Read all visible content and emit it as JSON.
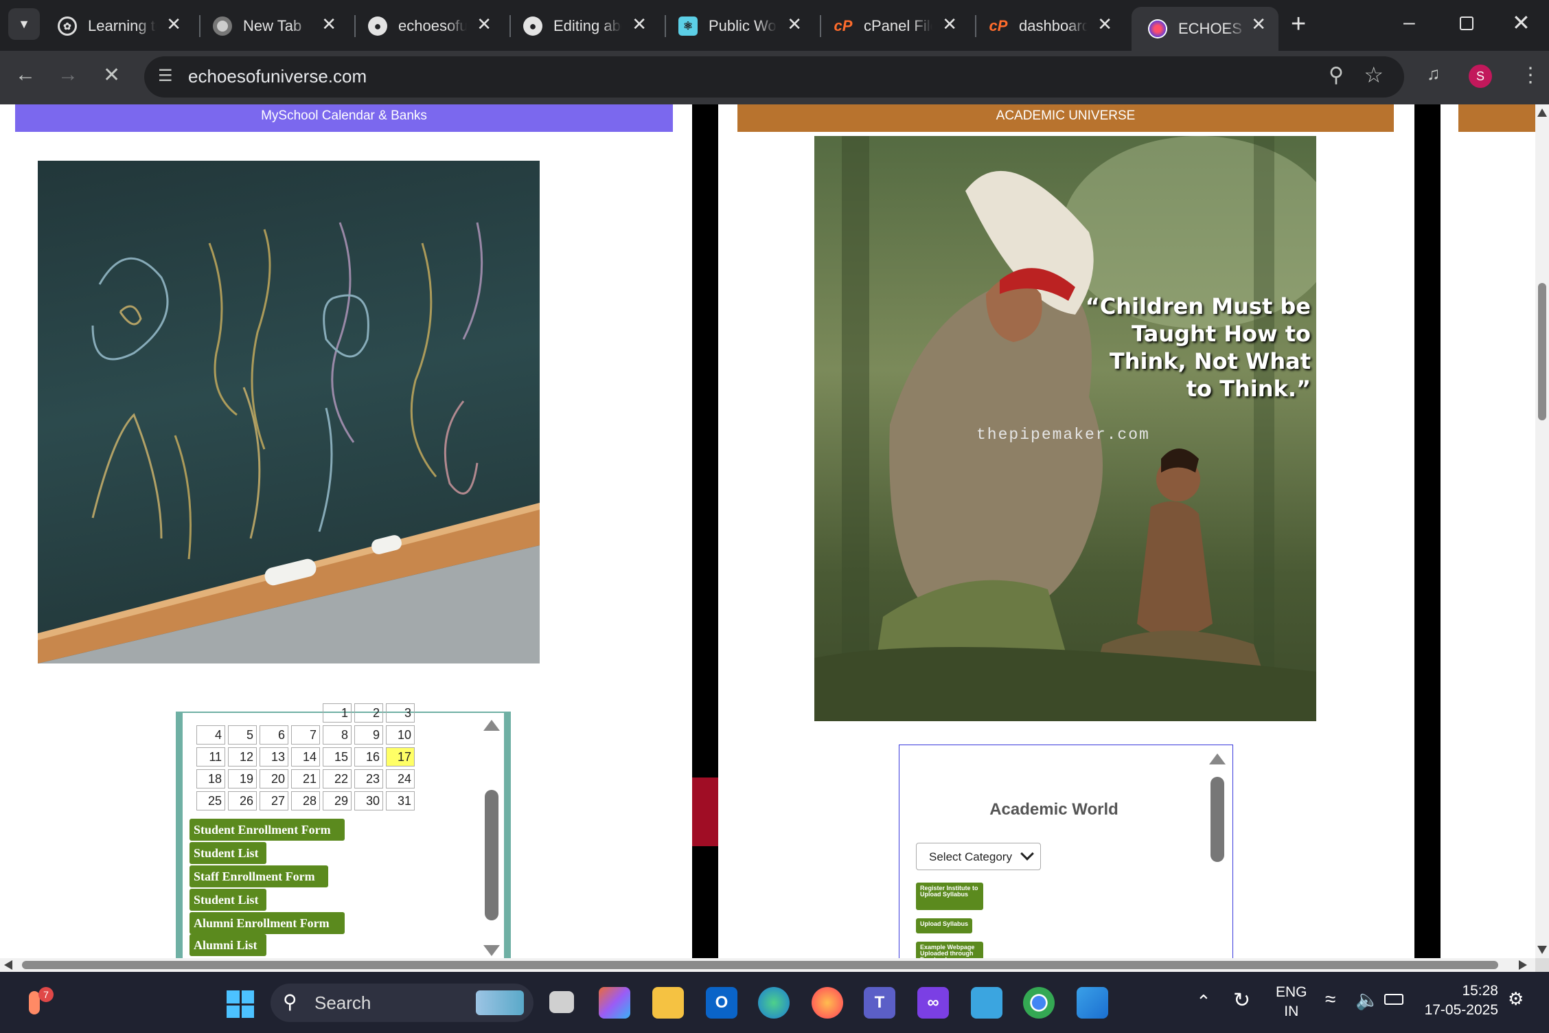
{
  "browser": {
    "tabs": [
      {
        "title": "Learning to",
        "favicon": "openai-icon"
      },
      {
        "title": "New Tab",
        "favicon": "chrome-icon"
      },
      {
        "title": "echoesofur",
        "favicon": "github-icon"
      },
      {
        "title": "Editing abo",
        "favicon": "github-icon"
      },
      {
        "title": "Public Wor",
        "favicon": "react-icon"
      },
      {
        "title": "cPanel File",
        "favicon": "cpanel-icon"
      },
      {
        "title": "dashboard",
        "favicon": "cpanel-icon"
      },
      {
        "title": "ECHOES O",
        "favicon": "echoes-icon",
        "active": true
      }
    ],
    "url": "echoesofuniverse.com",
    "profile_initial": "S"
  },
  "page": {
    "left": {
      "header": "MySchool Calendar & Banks",
      "calendar": {
        "rows": [
          [
            "",
            "",
            "",
            "",
            "1",
            "2",
            "3"
          ],
          [
            "4",
            "5",
            "6",
            "7",
            "8",
            "9",
            "10"
          ],
          [
            "11",
            "12",
            "13",
            "14",
            "15",
            "16",
            "17"
          ],
          [
            "18",
            "19",
            "20",
            "21",
            "22",
            "23",
            "24"
          ],
          [
            "25",
            "26",
            "27",
            "28",
            "29",
            "30",
            "31"
          ]
        ],
        "today": "17"
      },
      "links": [
        "Student Enrollment Form",
        "Student List",
        "Staff Enrollment Form",
        "Student List",
        "Alumni Enrollment Form",
        "Alumni List"
      ]
    },
    "center": {
      "header": "ACADEMIC UNIVERSE",
      "image_quote": "“Children Must be Taught How to Think, Not What to Think.”",
      "image_watermark": "thepipemaker.com",
      "widget_title": "Academic World",
      "select_placeholder": "Select Category",
      "buttons": [
        "Register Institute to Upload Syllabus",
        "Upload Syllabus",
        "Example Webpage Uploaded through Frontend"
      ]
    }
  },
  "taskbar": {
    "search": "Search",
    "notification_count": "7",
    "language": "ENG",
    "region": "IN",
    "time": "15:28",
    "date": "17-05-2025"
  },
  "colors": {
    "left_header": "#7b68ee",
    "center_header": "#b8732e",
    "link_green": "#5b8a1e",
    "today_highlight": "#ffff66"
  }
}
